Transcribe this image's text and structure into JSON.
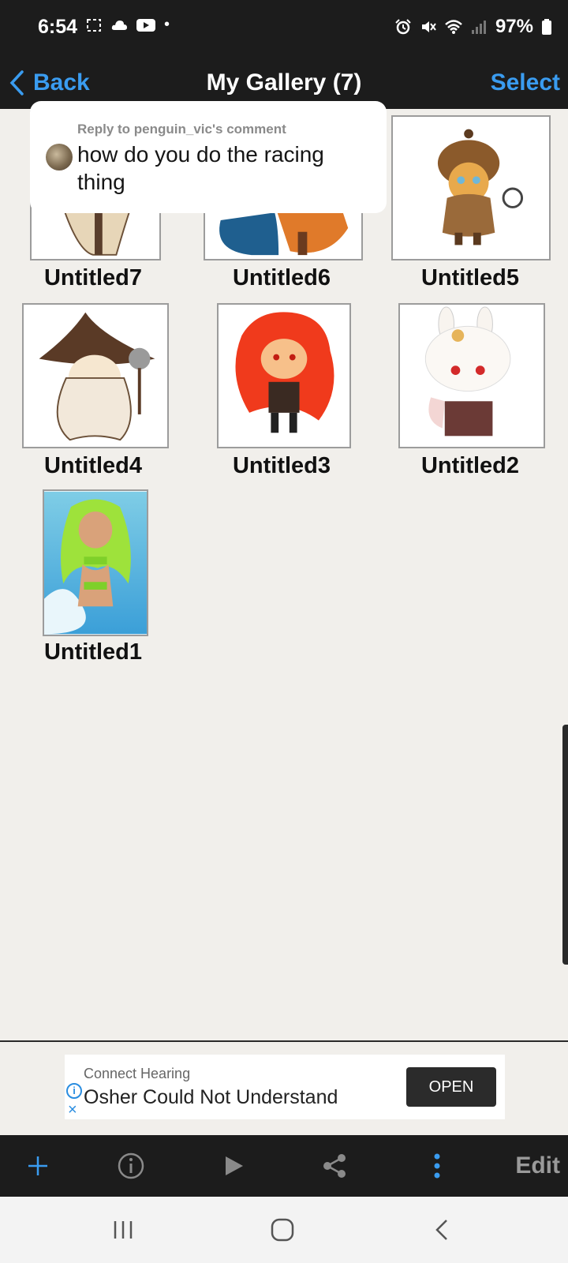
{
  "status_bar": {
    "time": "6:54",
    "dot": "•",
    "battery": "97%",
    "left_icons": [
      "screenshot-icon",
      "cloud-icon",
      "youtube-icon"
    ],
    "right_icons": [
      "alarm-icon",
      "mute-icon",
      "wifi-icon",
      "signal-icon",
      "battery-icon"
    ]
  },
  "nav": {
    "back_label": "Back",
    "title": "My Gallery (7)",
    "select_label": "Select"
  },
  "reply": {
    "header": "Reply to penguin_vic's comment",
    "text": "how do you do the racing thing"
  },
  "gallery": {
    "items": [
      {
        "title": "Untitled7"
      },
      {
        "title": "Untitled6"
      },
      {
        "title": "Untitled5"
      },
      {
        "title": "Untitled4"
      },
      {
        "title": "Untitled3"
      },
      {
        "title": "Untitled2"
      },
      {
        "title": "Untitled1"
      }
    ]
  },
  "ad": {
    "brand": "Connect Hearing",
    "text": "Osher Could Not Understand",
    "button": "OPEN",
    "info_glyph": "i",
    "close_glyph": "×"
  },
  "toolbar": {
    "items": [
      "add-icon",
      "info-icon",
      "play-icon",
      "share-icon",
      "more-icon"
    ],
    "edit_label": "Edit"
  },
  "system_nav": [
    "recent-apps-icon",
    "home-icon",
    "back-icon"
  ],
  "colors": {
    "accent": "#3a9cf0",
    "bar_bg": "#1c1c1c",
    "page_bg": "#f1efeb"
  }
}
